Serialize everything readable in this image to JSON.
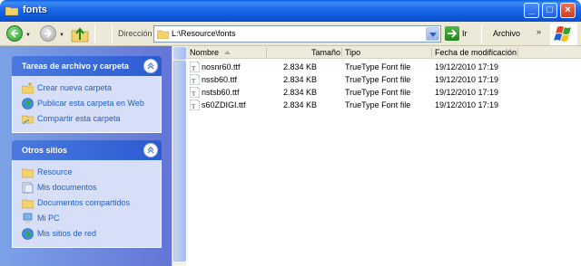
{
  "window": {
    "title": "fonts"
  },
  "toolbar": {
    "address_label": "Dirección",
    "address_value": "L:\\Resource\\fonts",
    "go_label": "Ir",
    "menu_label": "Archivo",
    "chevron": "»"
  },
  "tasks_panel": {
    "title": "Tareas de archivo y carpeta",
    "items": [
      {
        "label": "Crear nueva carpeta",
        "icon": "new-folder-icon"
      },
      {
        "label": "Publicar esta carpeta en Web",
        "icon": "globe-icon"
      },
      {
        "label": "Compartir esta carpeta",
        "icon": "share-folder-icon"
      }
    ]
  },
  "other_places_panel": {
    "title": "Otros sitios",
    "items": [
      {
        "label": "Resource",
        "icon": "folder-icon"
      },
      {
        "label": "Mis documentos",
        "icon": "documents-icon"
      },
      {
        "label": "Documentos compartidos",
        "icon": "folder-icon"
      },
      {
        "label": "Mi PC",
        "icon": "computer-icon"
      },
      {
        "label": "Mis sitios de red",
        "icon": "network-icon"
      }
    ]
  },
  "list": {
    "columns": [
      "Nombre",
      "Tamaño",
      "Tipo",
      "Fecha de modificación"
    ],
    "rows": [
      {
        "name": "nosnr60.ttf",
        "size": "2.834 KB",
        "type": "TrueType Font file",
        "date": "19/12/2010 17:19"
      },
      {
        "name": "nssb60.ttf",
        "size": "2.834 KB",
        "type": "TrueType Font file",
        "date": "19/12/2010 17:19"
      },
      {
        "name": "nstsb60.ttf",
        "size": "2.834 KB",
        "type": "TrueType Font file",
        "date": "19/12/2010 17:19"
      },
      {
        "name": "s60ZDIGI.ttf",
        "size": "2.834 KB",
        "type": "TrueType Font file",
        "date": "19/12/2010 17:19"
      }
    ]
  },
  "colors": {
    "title_bar": "#0a5fe0",
    "task_link": "#215dc6",
    "pane_bg": "#7ba2e7"
  }
}
